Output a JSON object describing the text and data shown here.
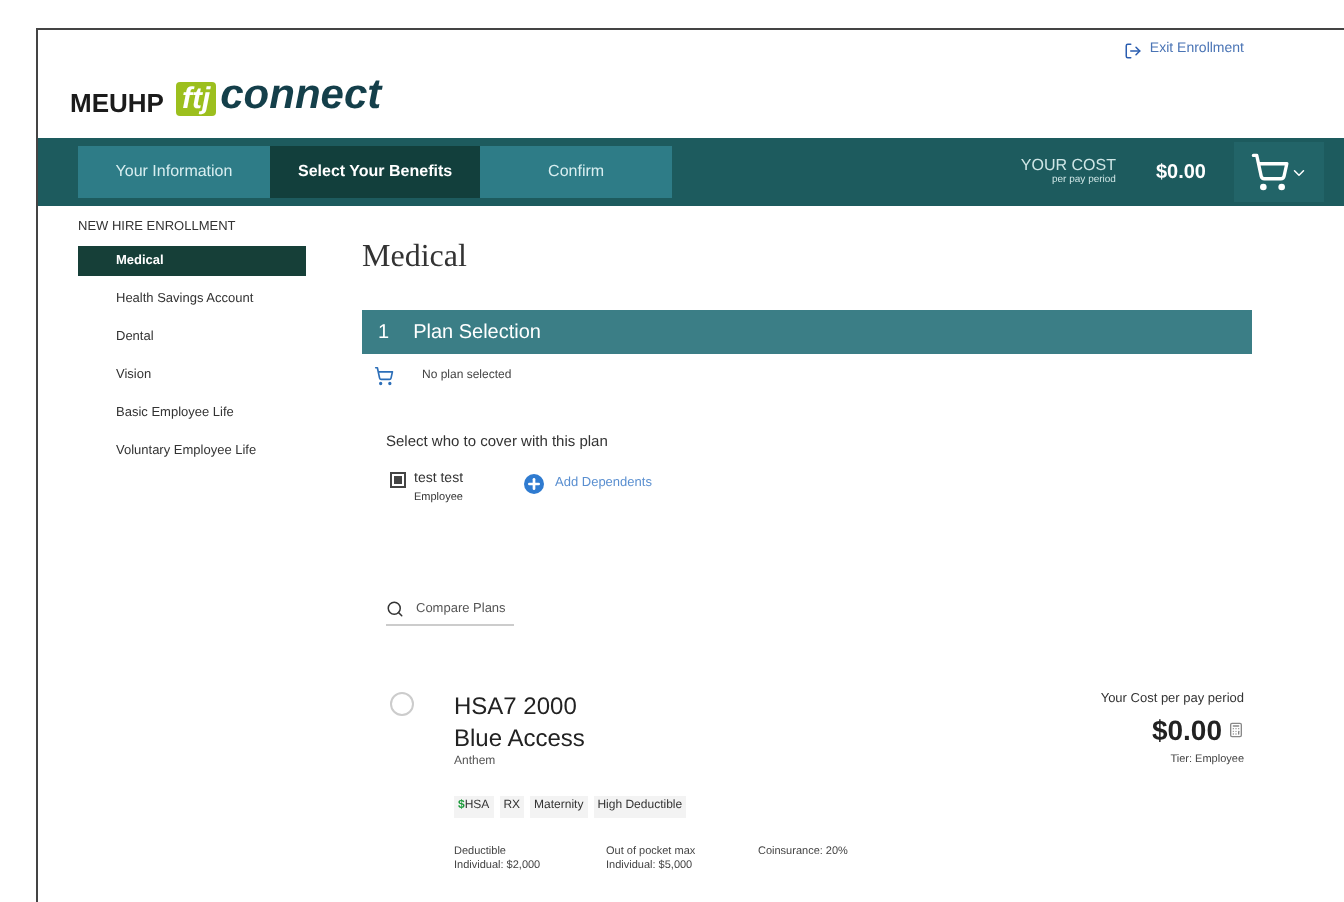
{
  "header": {
    "exit_link": "Exit Enrollment",
    "logo": {
      "org": "MEUHP",
      "badge": "ftj",
      "product": "connect"
    }
  },
  "steps": [
    {
      "label": "Your Information",
      "selected": false
    },
    {
      "label": "Select Your Benefits",
      "selected": true
    },
    {
      "label": "Confirm",
      "selected": false
    }
  ],
  "cost": {
    "title": "YOUR COST",
    "subtitle": "per pay period",
    "amount": "$0.00"
  },
  "sidebar": {
    "heading": "NEW HIRE ENROLLMENT",
    "items": [
      {
        "label": "Medical",
        "selected": true
      },
      {
        "label": "Health Savings Account",
        "selected": false
      },
      {
        "label": "Dental",
        "selected": false
      },
      {
        "label": "Vision",
        "selected": false
      },
      {
        "label": "Basic Employee Life",
        "selected": false
      },
      {
        "label": "Voluntary Employee Life",
        "selected": false
      }
    ]
  },
  "main": {
    "title": "Medical",
    "section": {
      "number": "1",
      "title": "Plan Selection"
    },
    "status": "No plan selected",
    "cover_heading": "Select who to cover with this plan",
    "members": [
      {
        "name": "test test",
        "role": "Employee",
        "checked": true
      }
    ],
    "add_dependents": "Add Dependents",
    "compare": "Compare Plans",
    "plans": [
      {
        "name_line1": "HSA7 2000",
        "name_line2": "Blue Access",
        "carrier": "Anthem",
        "selected": false,
        "cost_label": "Your Cost per pay period",
        "cost": "$0.00",
        "tier": "Tier: Employee",
        "tags": [
          {
            "prefix": "$",
            "label": "HSA"
          },
          {
            "label": "RX"
          },
          {
            "label": "Maternity"
          },
          {
            "label": "High Deductible"
          }
        ],
        "details": [
          {
            "label": "Deductible",
            "value": "Individual: $2,000"
          },
          {
            "label": "Out of pocket max",
            "value": "Individual: $5,000"
          },
          {
            "label": "Coinsurance: 20%"
          }
        ]
      }
    ]
  }
}
